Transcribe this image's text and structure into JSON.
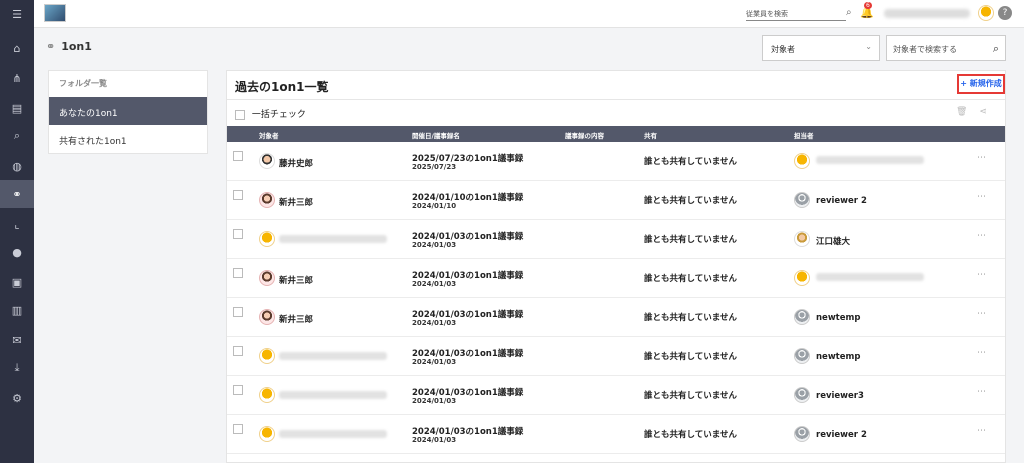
{
  "header": {
    "employee_search_placeholder": "従業員を検索",
    "notification_count": "6"
  },
  "page": {
    "title": "1on1"
  },
  "filters": {
    "target_select_value": "対象者",
    "target_search_placeholder": "対象者で検索する"
  },
  "folders": {
    "title": "フォルダ一覧",
    "items": [
      {
        "label": "あなたの1on1"
      },
      {
        "label": "共有された1on1"
      }
    ]
  },
  "list": {
    "title": "過去の1on1一覧",
    "new_button": "+ 新規作成",
    "check_all": "一括チェック",
    "columns": [
      "対象者",
      "開催日/議事録名",
      "議事録の内容",
      "共有",
      "担当者"
    ],
    "rows": [
      {
        "target": "藤井史郎",
        "target_avatar": "person",
        "title": "2025/07/23の1on1議事録",
        "date": "2025/07/23",
        "share": "誰とも共有していません",
        "owner": "",
        "owner_avatar": "mascot"
      },
      {
        "target": "新井三郎",
        "target_avatar": "woman",
        "title": "2024/01/10の1on1議事録",
        "date": "2024/01/10",
        "share": "誰とも共有していません",
        "owner": "reviewer 2",
        "owner_avatar": "grey"
      },
      {
        "target": "",
        "target_avatar": "mascot",
        "title": "2024/01/03の1on1議事録",
        "date": "2024/01/03",
        "share": "誰とも共有していません",
        "owner": "江口雄大",
        "owner_avatar": "man"
      },
      {
        "target": "新井三郎",
        "target_avatar": "woman",
        "title": "2024/01/03の1on1議事録",
        "date": "2024/01/03",
        "share": "誰とも共有していません",
        "owner": "",
        "owner_avatar": "mascot"
      },
      {
        "target": "新井三郎",
        "target_avatar": "woman",
        "title": "2024/01/03の1on1議事録",
        "date": "2024/01/03",
        "share": "誰とも共有していません",
        "owner": "newtemp",
        "owner_avatar": "grey"
      },
      {
        "target": "",
        "target_avatar": "mascot",
        "title": "2024/01/03の1on1議事録",
        "date": "2024/01/03",
        "share": "誰とも共有していません",
        "owner": "newtemp",
        "owner_avatar": "grey"
      },
      {
        "target": "",
        "target_avatar": "mascot",
        "title": "2024/01/03の1on1議事録",
        "date": "2024/01/03",
        "share": "誰とも共有していません",
        "owner": "reviewer3",
        "owner_avatar": "grey"
      },
      {
        "target": "",
        "target_avatar": "mascot",
        "title": "2024/01/03の1on1議事録",
        "date": "2024/01/03",
        "share": "誰とも共有していません",
        "owner": "reviewer 2",
        "owner_avatar": "grey"
      }
    ]
  },
  "sidebar_icons": [
    "menu-icon",
    "home-icon",
    "org-chart-icon",
    "document-icon",
    "search-icon",
    "chat-icon",
    "link-icon",
    "chart-icon",
    "globe-icon",
    "contact-card-icon",
    "book-icon",
    "mail-icon",
    "download-icon",
    "user-settings-icon"
  ]
}
